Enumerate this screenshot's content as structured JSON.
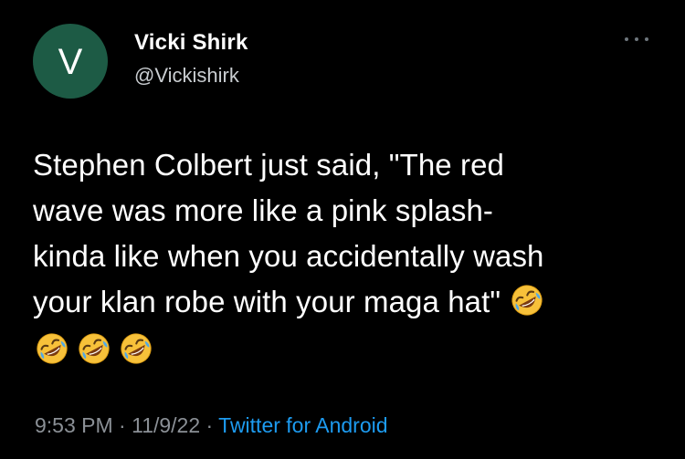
{
  "author": {
    "avatar_letter": "V",
    "avatar_color": "#1d5b45",
    "display_name": "Vicki Shirk",
    "handle": "@Vickishirk"
  },
  "tweet": {
    "lines": [
      "Stephen Colbert just said, \"The red",
      "wave was more like a pink splash-",
      "kinda like when you accidentally wash",
      "your klan robe with your maga hat\""
    ],
    "emoji_name": "rolling-on-the-floor-laughing",
    "emoji_count_inline": 1,
    "emoji_count_row": 3
  },
  "meta": {
    "time": "9:53 PM",
    "separator": " · ",
    "date": "11/9/22",
    "source": "Twitter for Android"
  },
  "colors": {
    "background": "#000000",
    "text": "#ffffff",
    "secondary": "#8b9096",
    "link": "#1d9bf0"
  },
  "icons": {
    "more": "more-options-icon"
  }
}
